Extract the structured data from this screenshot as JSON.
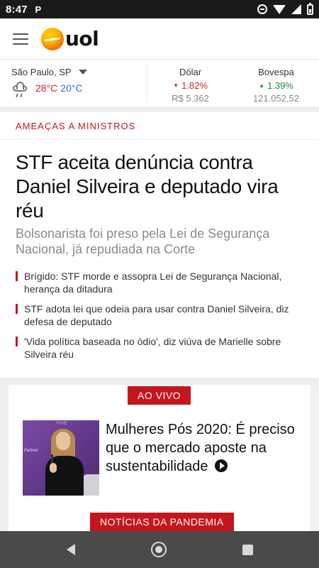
{
  "status_bar": {
    "time": "8:47",
    "notification_letter": "P"
  },
  "app": {
    "logo_text": "uol"
  },
  "ticker": {
    "weather": {
      "city": "São Paulo, SP",
      "max": "28°C",
      "min": "20°C"
    },
    "markets": [
      {
        "name": "Dólar",
        "change": "1.82%",
        "direction": "down",
        "value": "R$ 5.362"
      },
      {
        "name": "Bovespa",
        "change": "1.39%",
        "direction": "up",
        "value": "121.052,52"
      }
    ]
  },
  "headline": {
    "kicker": "AMEAÇAS A MINISTROS",
    "title": "STF aceita denúncia contra Daniel Silveira e deputado vira réu",
    "subtitle": "Bolsonarista foi preso pela Lei de Segurança Nacional, já repudiada na Corte",
    "related": [
      "Brígido: STF morde e assopra Lei de Segurança Nacional, herança da ditadura",
      "STF adota lei que odeia para usar contra Daniel Silveira, diz defesa de deputado",
      "'Vida política baseada no ódio', diz viúva de Marielle sobre Silveira réu"
    ]
  },
  "live": {
    "badge": "AO VIVO",
    "title": "Mulheres Pós 2020: É preciso que o mercado aposte na sustentabilidade",
    "next_badge": "NOTÍCIAS DA PANDEMIA"
  },
  "colors": {
    "accent": "#c4161c",
    "up": "#1f8a3a",
    "temp_min": "#2e6fd9"
  },
  "icons": [
    "menu-icon",
    "uol-logo",
    "cloud-rain-icon",
    "caret-down-icon",
    "play-icon",
    "back-icon",
    "home-icon",
    "recents-icon"
  ]
}
